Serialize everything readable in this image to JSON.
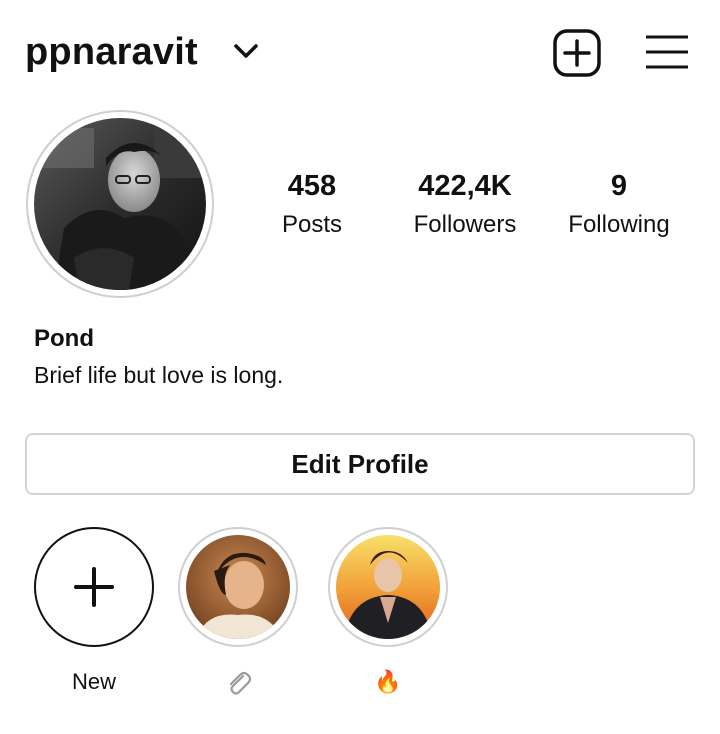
{
  "header": {
    "username": "ppnaravit",
    "icons": {
      "dropdown": "chevron-down-icon",
      "add_post": "plus-square-icon",
      "menu": "hamburger-menu-icon"
    }
  },
  "profile": {
    "stats": [
      {
        "value": "458",
        "label": "Posts"
      },
      {
        "value": "422,4K",
        "label": "Followers"
      },
      {
        "value": "9",
        "label": "Following"
      }
    ],
    "name": "Pond",
    "bio": "Brief life but love is long."
  },
  "actions": {
    "edit_profile_label": "Edit Profile"
  },
  "highlights": [
    {
      "label": "New",
      "icon": "plus-icon"
    },
    {
      "label": "📎",
      "icon": "paperclip-icon"
    },
    {
      "label": "🔥",
      "icon": "fire-icon"
    }
  ],
  "colors": {
    "text": "#111111",
    "border": "#d4d4d4",
    "ring": "#cfcfcf",
    "background": "#ffffff"
  }
}
